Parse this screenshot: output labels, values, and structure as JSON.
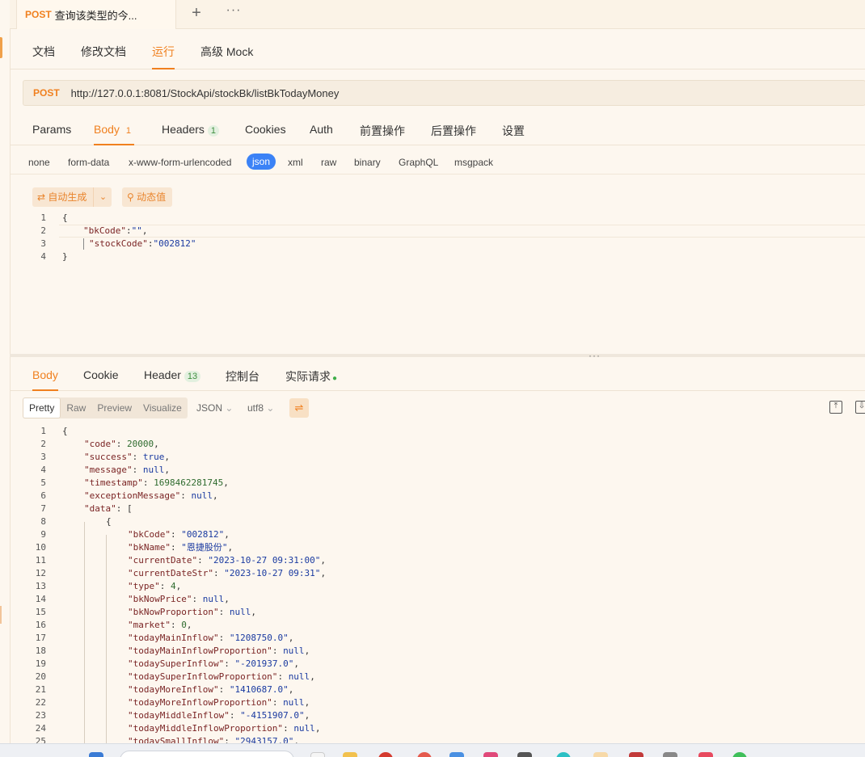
{
  "request_tab": {
    "method": "POST",
    "title": "查询该类型的今..."
  },
  "tab_controls": {
    "add": "+",
    "more": "···"
  },
  "subtabs": [
    "文档",
    "修改文档",
    "运行",
    "高级 Mock"
  ],
  "url": {
    "method": "POST",
    "value": "http://127.0.0.1:8081/StockApi/stockBk/listBkTodayMoney"
  },
  "param_tabs": {
    "params": "Params",
    "body": "Body",
    "body_count": "1",
    "headers": "Headers",
    "headers_count": "1",
    "cookies": "Cookies",
    "auth": "Auth",
    "pre": "前置操作",
    "post": "后置操作",
    "settings": "设置"
  },
  "body_types": [
    "none",
    "form-data",
    "x-www-form-urlencoded",
    "json",
    "xml",
    "raw",
    "binary",
    "GraphQL",
    "msgpack"
  ],
  "body_tools": {
    "auto_generate": "自动生成",
    "dynamic_value": "动态值"
  },
  "request_body": {
    "line_numbers": [
      "1",
      "2",
      "3",
      "4"
    ],
    "open": "{",
    "k1": "\"bkCode\"",
    "v1": "\"\"",
    "k2": "\"stockCode\"",
    "v2": "\"002812\"",
    "close": "}"
  },
  "response_tabs": {
    "body": "Body",
    "cookie": "Cookie",
    "header": "Header",
    "header_count": "13",
    "console": "控制台",
    "actual": "实际请求"
  },
  "view_modes": {
    "pretty": "Pretty",
    "raw": "Raw",
    "preview": "Preview",
    "visualize": "Visualize",
    "format": "JSON",
    "encoding": "utf8"
  },
  "response_lines": [
    {
      "n": "1",
      "t": [
        [
          "p",
          "{"
        ]
      ],
      "ind": 0
    },
    {
      "n": "2",
      "t": [
        [
          "k",
          "\"code\""
        ],
        [
          "p",
          ": "
        ],
        [
          "n",
          "20000"
        ],
        [
          "p",
          ","
        ]
      ],
      "ind": 1
    },
    {
      "n": "3",
      "t": [
        [
          "k",
          "\"success\""
        ],
        [
          "p",
          ": "
        ],
        [
          "kw",
          "true"
        ],
        [
          "p",
          ","
        ]
      ],
      "ind": 1
    },
    {
      "n": "4",
      "t": [
        [
          "k",
          "\"message\""
        ],
        [
          "p",
          ": "
        ],
        [
          "kw",
          "null"
        ],
        [
          "p",
          ","
        ]
      ],
      "ind": 1
    },
    {
      "n": "5",
      "t": [
        [
          "k",
          "\"timestamp\""
        ],
        [
          "p",
          ": "
        ],
        [
          "n",
          "1698462281745"
        ],
        [
          "p",
          ","
        ]
      ],
      "ind": 1
    },
    {
      "n": "6",
      "t": [
        [
          "k",
          "\"exceptionMessage\""
        ],
        [
          "p",
          ": "
        ],
        [
          "kw",
          "null"
        ],
        [
          "p",
          ","
        ]
      ],
      "ind": 1
    },
    {
      "n": "7",
      "t": [
        [
          "k",
          "\"data\""
        ],
        [
          "p",
          ": ["
        ]
      ],
      "ind": 1
    },
    {
      "n": "8",
      "t": [
        [
          "p",
          "{"
        ]
      ],
      "ind": 2
    },
    {
      "n": "9",
      "t": [
        [
          "k",
          "\"bkCode\""
        ],
        [
          "p",
          ": "
        ],
        [
          "s",
          "\"002812\""
        ],
        [
          "p",
          ","
        ]
      ],
      "ind": 3
    },
    {
      "n": "10",
      "t": [
        [
          "k",
          "\"bkName\""
        ],
        [
          "p",
          ": "
        ],
        [
          "s",
          "\"恩捷股份\""
        ],
        [
          "p",
          ","
        ]
      ],
      "ind": 3
    },
    {
      "n": "11",
      "t": [
        [
          "k",
          "\"currentDate\""
        ],
        [
          "p",
          ": "
        ],
        [
          "s",
          "\"2023-10-27 09:31:00\""
        ],
        [
          "p",
          ","
        ]
      ],
      "ind": 3
    },
    {
      "n": "12",
      "t": [
        [
          "k",
          "\"currentDateStr\""
        ],
        [
          "p",
          ": "
        ],
        [
          "s",
          "\"2023-10-27 09:31\""
        ],
        [
          "p",
          ","
        ]
      ],
      "ind": 3
    },
    {
      "n": "13",
      "t": [
        [
          "k",
          "\"type\""
        ],
        [
          "p",
          ": "
        ],
        [
          "n",
          "4"
        ],
        [
          "p",
          ","
        ]
      ],
      "ind": 3
    },
    {
      "n": "14",
      "t": [
        [
          "k",
          "\"bkNowPrice\""
        ],
        [
          "p",
          ": "
        ],
        [
          "kw",
          "null"
        ],
        [
          "p",
          ","
        ]
      ],
      "ind": 3
    },
    {
      "n": "15",
      "t": [
        [
          "k",
          "\"bkNowProportion\""
        ],
        [
          "p",
          ": "
        ],
        [
          "kw",
          "null"
        ],
        [
          "p",
          ","
        ]
      ],
      "ind": 3
    },
    {
      "n": "16",
      "t": [
        [
          "k",
          "\"market\""
        ],
        [
          "p",
          ": "
        ],
        [
          "n",
          "0"
        ],
        [
          "p",
          ","
        ]
      ],
      "ind": 3
    },
    {
      "n": "17",
      "t": [
        [
          "k",
          "\"todayMainInflow\""
        ],
        [
          "p",
          ": "
        ],
        [
          "s",
          "\"1208750.0\""
        ],
        [
          "p",
          ","
        ]
      ],
      "ind": 3
    },
    {
      "n": "18",
      "t": [
        [
          "k",
          "\"todayMainInflowProportion\""
        ],
        [
          "p",
          ": "
        ],
        [
          "kw",
          "null"
        ],
        [
          "p",
          ","
        ]
      ],
      "ind": 3
    },
    {
      "n": "19",
      "t": [
        [
          "k",
          "\"todaySuperInflow\""
        ],
        [
          "p",
          ": "
        ],
        [
          "s",
          "\"-201937.0\""
        ],
        [
          "p",
          ","
        ]
      ],
      "ind": 3
    },
    {
      "n": "20",
      "t": [
        [
          "k",
          "\"todaySuperInflowProportion\""
        ],
        [
          "p",
          ": "
        ],
        [
          "kw",
          "null"
        ],
        [
          "p",
          ","
        ]
      ],
      "ind": 3
    },
    {
      "n": "21",
      "t": [
        [
          "k",
          "\"todayMoreInflow\""
        ],
        [
          "p",
          ": "
        ],
        [
          "s",
          "\"1410687.0\""
        ],
        [
          "p",
          ","
        ]
      ],
      "ind": 3
    },
    {
      "n": "22",
      "t": [
        [
          "k",
          "\"todayMoreInflowProportion\""
        ],
        [
          "p",
          ": "
        ],
        [
          "kw",
          "null"
        ],
        [
          "p",
          ","
        ]
      ],
      "ind": 3
    },
    {
      "n": "23",
      "t": [
        [
          "k",
          "\"todayMiddleInflow\""
        ],
        [
          "p",
          ": "
        ],
        [
          "s",
          "\"-4151907.0\""
        ],
        [
          "p",
          ","
        ]
      ],
      "ind": 3
    },
    {
      "n": "24",
      "t": [
        [
          "k",
          "\"todayMiddleInflowProportion\""
        ],
        [
          "p",
          ": "
        ],
        [
          "kw",
          "null"
        ],
        [
          "p",
          ","
        ]
      ],
      "ind": 3
    },
    {
      "n": "25",
      "t": [
        [
          "k",
          "\"todaySmallInflow\""
        ],
        [
          "p",
          ": "
        ],
        [
          "s",
          "\"2943157.0\""
        ],
        [
          "p",
          ","
        ]
      ],
      "ind": 3
    }
  ],
  "colors": {
    "accent": "#f0801f",
    "background": "#fdf7ef",
    "json_active": "#3b82f6"
  }
}
